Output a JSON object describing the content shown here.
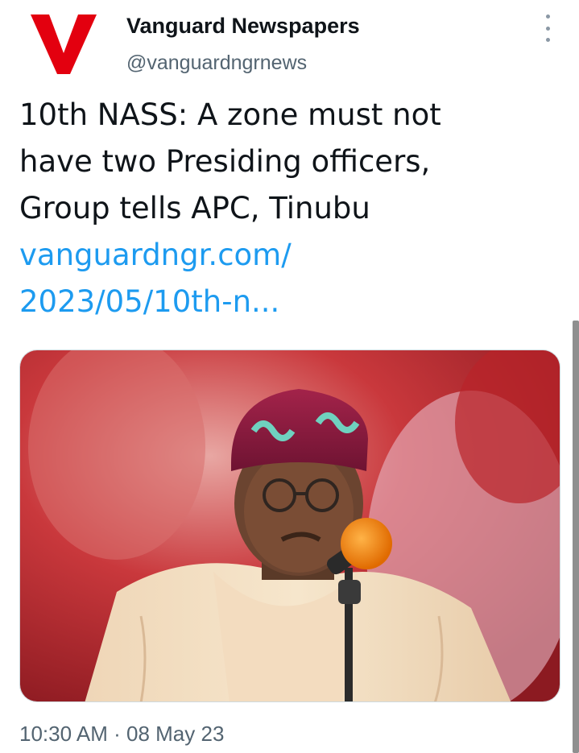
{
  "author": {
    "display_name": "Vanguard Newspapers",
    "handle": "@vanguardngrnews",
    "avatar_icon": "vanguard-v-logo",
    "brand_color": "#e3000f"
  },
  "tweet": {
    "text_lines": [
      "10th NASS: A zone must not",
      "have two Presiding officers,",
      "Group tells APC, Tinubu"
    ],
    "link_lines": [
      "vanguardngr.com/",
      "2023/05/10th-n..."
    ],
    "time": "10:30 AM",
    "separator": "·",
    "date": "08 May 23"
  },
  "more_options": {
    "icon": "more-vertical-icon"
  },
  "colors": {
    "link": "#1d9bf0",
    "secondary_text": "#536471",
    "primary_text": "#0f1419"
  }
}
